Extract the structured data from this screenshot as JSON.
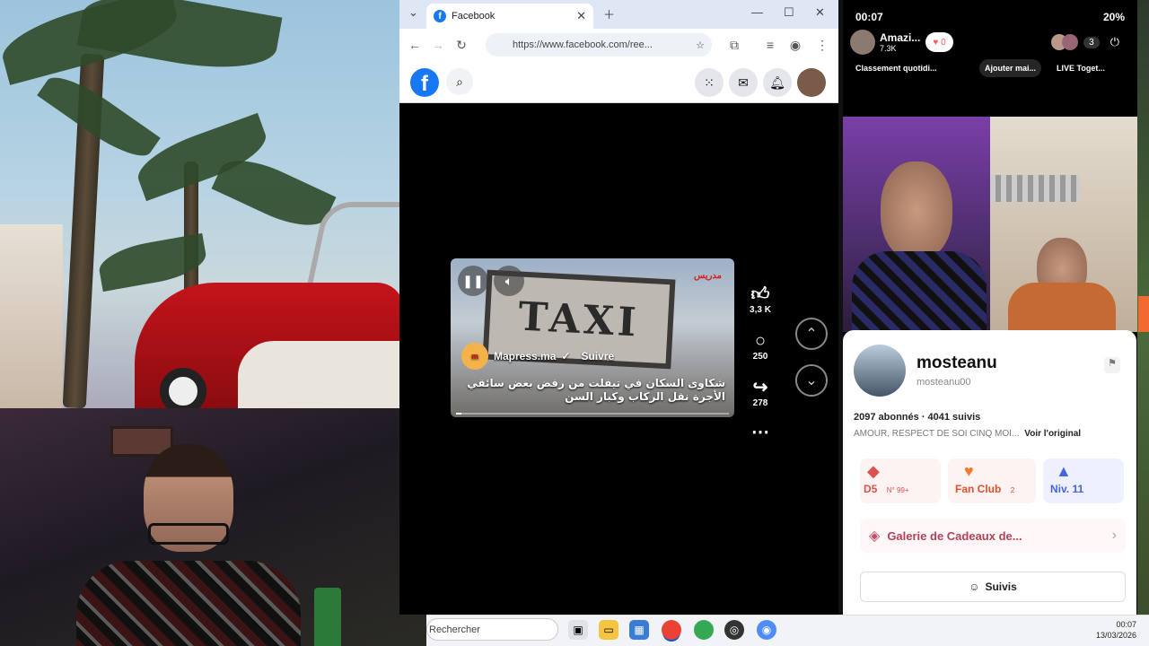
{
  "browser": {
    "tab_title": "Facebook",
    "url": "https://www.facebook.com/ree...",
    "fb_logo": "f"
  },
  "reel": {
    "author": "Mapress.ma",
    "follow_label": "Suivre",
    "brand_mark": "مدريس",
    "caption": "شكاوى السكان في تيفلت من رفض بعض سائقي الأجرة نقل الركاب وكبار السن",
    "sign_text": "TAXI",
    "progress": 0.02,
    "likes": "3,3 K",
    "comments": "250",
    "shares": "278"
  },
  "phone": {
    "time": "00:07",
    "battery": "20%",
    "host_name": "Amazi...",
    "host_likes": "7.3K",
    "like_count": "0",
    "viewers": "3",
    "chips": [
      "Classement quotidi...",
      "Ajouter mai...",
      "LIVE Toget..."
    ],
    "profile": {
      "name": "mosteanu",
      "handle": "mosteanu00",
      "stats": "2097 abonnés · 4041 suivis",
      "bio": "AMOUR, RESPECT DE SOI CINQ MOI...",
      "see_original": "Voir l'original",
      "badges": [
        {
          "label": "D5",
          "sub": "N° 99+",
          "color": "#d9534f"
        },
        {
          "label": "Fan Club",
          "sub": "2",
          "color": "#f27b32"
        },
        {
          "label": "Niv. 11",
          "sub": "",
          "color": "#4a62e0"
        }
      ],
      "gift_gallery": "Galerie de Cadeaux de...",
      "follow_button": "Suivis"
    }
  },
  "taskbar": {
    "search_placeholder": "Rechercher",
    "time": "00:07",
    "date": "13/03/2026"
  },
  "colors": {
    "facebook_blue": "#1877f2",
    "car_red": "#c4141b",
    "fan_orange": "#f27b32"
  }
}
